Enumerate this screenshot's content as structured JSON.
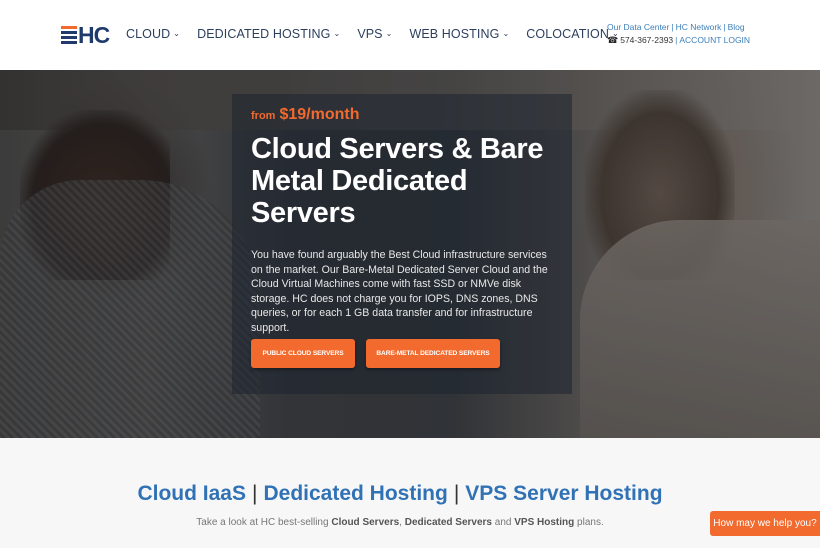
{
  "header": {
    "logo_text": "HC",
    "nav": [
      {
        "label": "CLOUD",
        "chevron": "chevron-down-icon"
      },
      {
        "label": "DEDICATED HOSTING",
        "chevron": "chevron-down-icon"
      },
      {
        "label": "VPS",
        "chevron": "chevron-down-icon"
      },
      {
        "label": "WEB HOSTING",
        "chevron": "chevron-down-icon"
      },
      {
        "label": "COLOCATION",
        "chevron": "chevron-down-icon"
      }
    ],
    "utility": {
      "links": [
        "Our Data Center",
        "HC Network",
        "Blog"
      ],
      "separator": "|",
      "phone_icon": "☎",
      "phone": "574-367-2393",
      "account_login": "ACCOUNT LOGIN"
    }
  },
  "hero": {
    "price_prefix": "from",
    "price": "$19/month",
    "headline": "Cloud Servers & Bare Metal Dedicated Servers",
    "description": "You have found arguably the Best Cloud infrastructure services on the market. Our Bare-Metal Dedicated Server Cloud and the Cloud Virtual Machines come with fast SSD or NMVe disk storage. HC does not charge you for IOPS, DNS zones, DNS queries, or for each 1 GB data transfer and for infrastructure support.",
    "buttons": [
      "PUBLIC CLOUD SERVERS",
      "BARE-METAL DEDICATED SERVERS"
    ]
  },
  "section": {
    "title_parts": [
      "Cloud IaaS",
      "Dedicated Hosting",
      "VPS Server Hosting"
    ],
    "title_separator": "|",
    "subtitle": {
      "pre": "Take a look at HC best-selling ",
      "b1": "Cloud Servers",
      "mid1": ", ",
      "b2": "Dedicated Servers",
      "mid2": " and ",
      "b3": "VPS Hosting",
      "post": " plans."
    }
  },
  "chat": {
    "label": "How may we help you?"
  },
  "colors": {
    "accent": "#f26a2e",
    "brand_navy": "#1f3a6b",
    "link_blue": "#3072b5"
  }
}
